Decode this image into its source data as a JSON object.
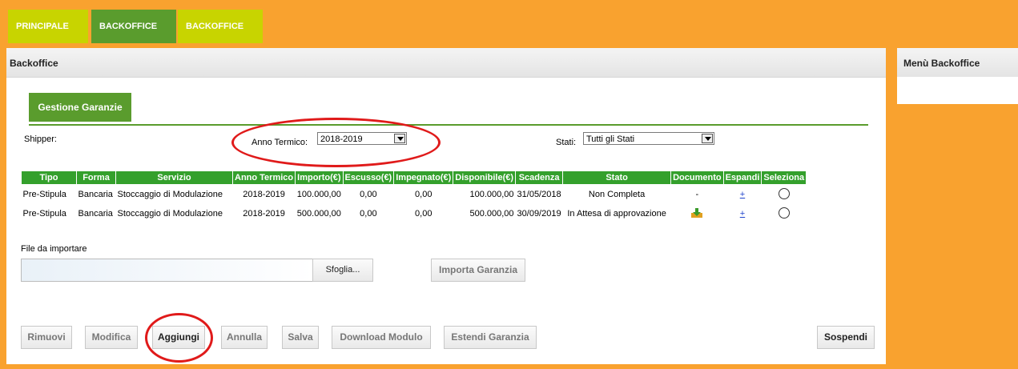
{
  "top_tabs": [
    "PRINCIPALE",
    "BACKOFFICE",
    "BACKOFFICE"
  ],
  "main": {
    "title": "Backoffice"
  },
  "side": {
    "title": "Menù Backoffice"
  },
  "section_tab": "Gestione Garanzie",
  "filters": {
    "shipper_label": "Shipper:",
    "anno_label": "Anno Termico:",
    "anno_value": "2018-2019",
    "stati_label": "Stati:",
    "stati_value": "Tutti gli Stati"
  },
  "table": {
    "headers": [
      "Tipo",
      "Forma",
      "Servizio",
      "Anno Termico",
      "Importo(€)",
      "Escusso(€)",
      "Impegnato(€)",
      "Disponibile(€)",
      "Scadenza",
      "Stato",
      "Documento",
      "Espandi",
      "Seleziona"
    ],
    "rows": [
      {
        "tipo": "Pre-Stipula",
        "forma": "Bancaria",
        "servizio": "Stoccaggio di Modulazione",
        "anno": "2018-2019",
        "importo": "100.000,00",
        "escusso": "0,00",
        "impegnato": "0,00",
        "disponibile": "100.000,00",
        "scadenza": "31/05/2018",
        "stato": "Non Completa",
        "documento": "-",
        "espandi": "+",
        "doc_icon": "download-document-icon"
      },
      {
        "tipo": "Pre-Stipula",
        "forma": "Bancaria",
        "servizio": "Stoccaggio di Modulazione",
        "anno": "2018-2019",
        "importo": "500.000,00",
        "escusso": "0,00",
        "impegnato": "0,00",
        "disponibile": "500.000,00",
        "scadenza": "30/09/2019",
        "stato": "In Attesa di approvazione",
        "documento": "",
        "espandi": "+",
        "doc_icon": "download-document-icon"
      }
    ]
  },
  "file_import": {
    "label": "File da importare",
    "browse": "Sfoglia...",
    "import": "Importa Garanzia"
  },
  "actions": {
    "rimuovi": "Rimuovi",
    "modifica": "Modifica",
    "aggiungi": "Aggiungi",
    "annulla": "Annulla",
    "salva": "Salva",
    "download": "Download Modulo",
    "estendi": "Estendi Garanzia",
    "sospendi": "Sospendi"
  },
  "annotation_color": "#e01a1a"
}
